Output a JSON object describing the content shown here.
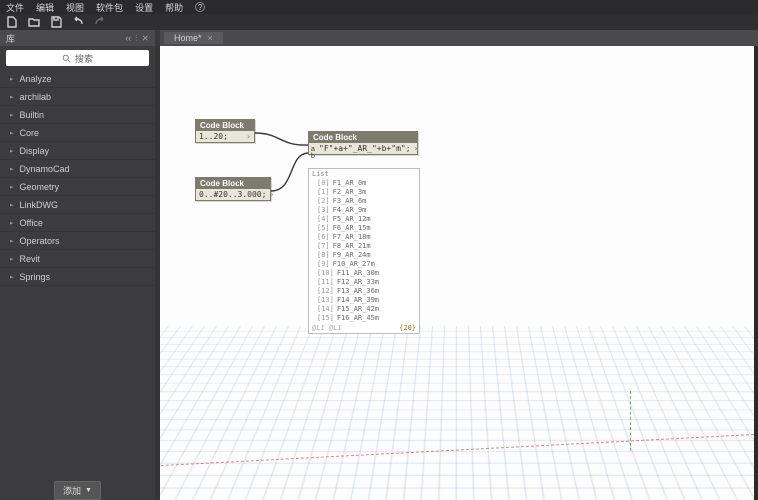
{
  "menu": {
    "items": [
      "文件",
      "编辑",
      "视图",
      "软件包",
      "设置",
      "帮助"
    ]
  },
  "tabs": {
    "home": "Home*"
  },
  "sidebar": {
    "title": "库",
    "search_placeholder": "搜索",
    "items": [
      "Analyze",
      "archilab",
      "Builtin",
      "Core",
      "Display",
      "DynamoCad",
      "Geometry",
      "LinkDWG",
      "Office",
      "Operators",
      "Revit",
      "Springs"
    ],
    "add_label": "添加"
  },
  "nodes": {
    "n1": {
      "title": "Code Block",
      "code": "1..20;"
    },
    "n2": {
      "title": "Code Block",
      "code": "0..#20..3.000;"
    },
    "n3": {
      "title": "Code Block",
      "in_ports": [
        "a",
        "b"
      ],
      "code": "\"F\"+a+\"_AR_\"+b+\"m\";"
    }
  },
  "output": {
    "label": "List",
    "items": [
      "F1_AR_0m",
      "F2_AR_3m",
      "F3_AR_6m",
      "F4_AR_9m",
      "F5_AR_12m",
      "F6_AR_15m",
      "F7_AR_18m",
      "F8_AR_21m",
      "F9_AR_24m",
      "F10_AR_27m",
      "F11_AR_30m",
      "F12_AR_33m",
      "F13_AR_36m",
      "F14_AR_39m",
      "F15_AR_42m",
      "F16_AR_45m"
    ],
    "dims": "@L1 @L1",
    "count": "{20}"
  }
}
